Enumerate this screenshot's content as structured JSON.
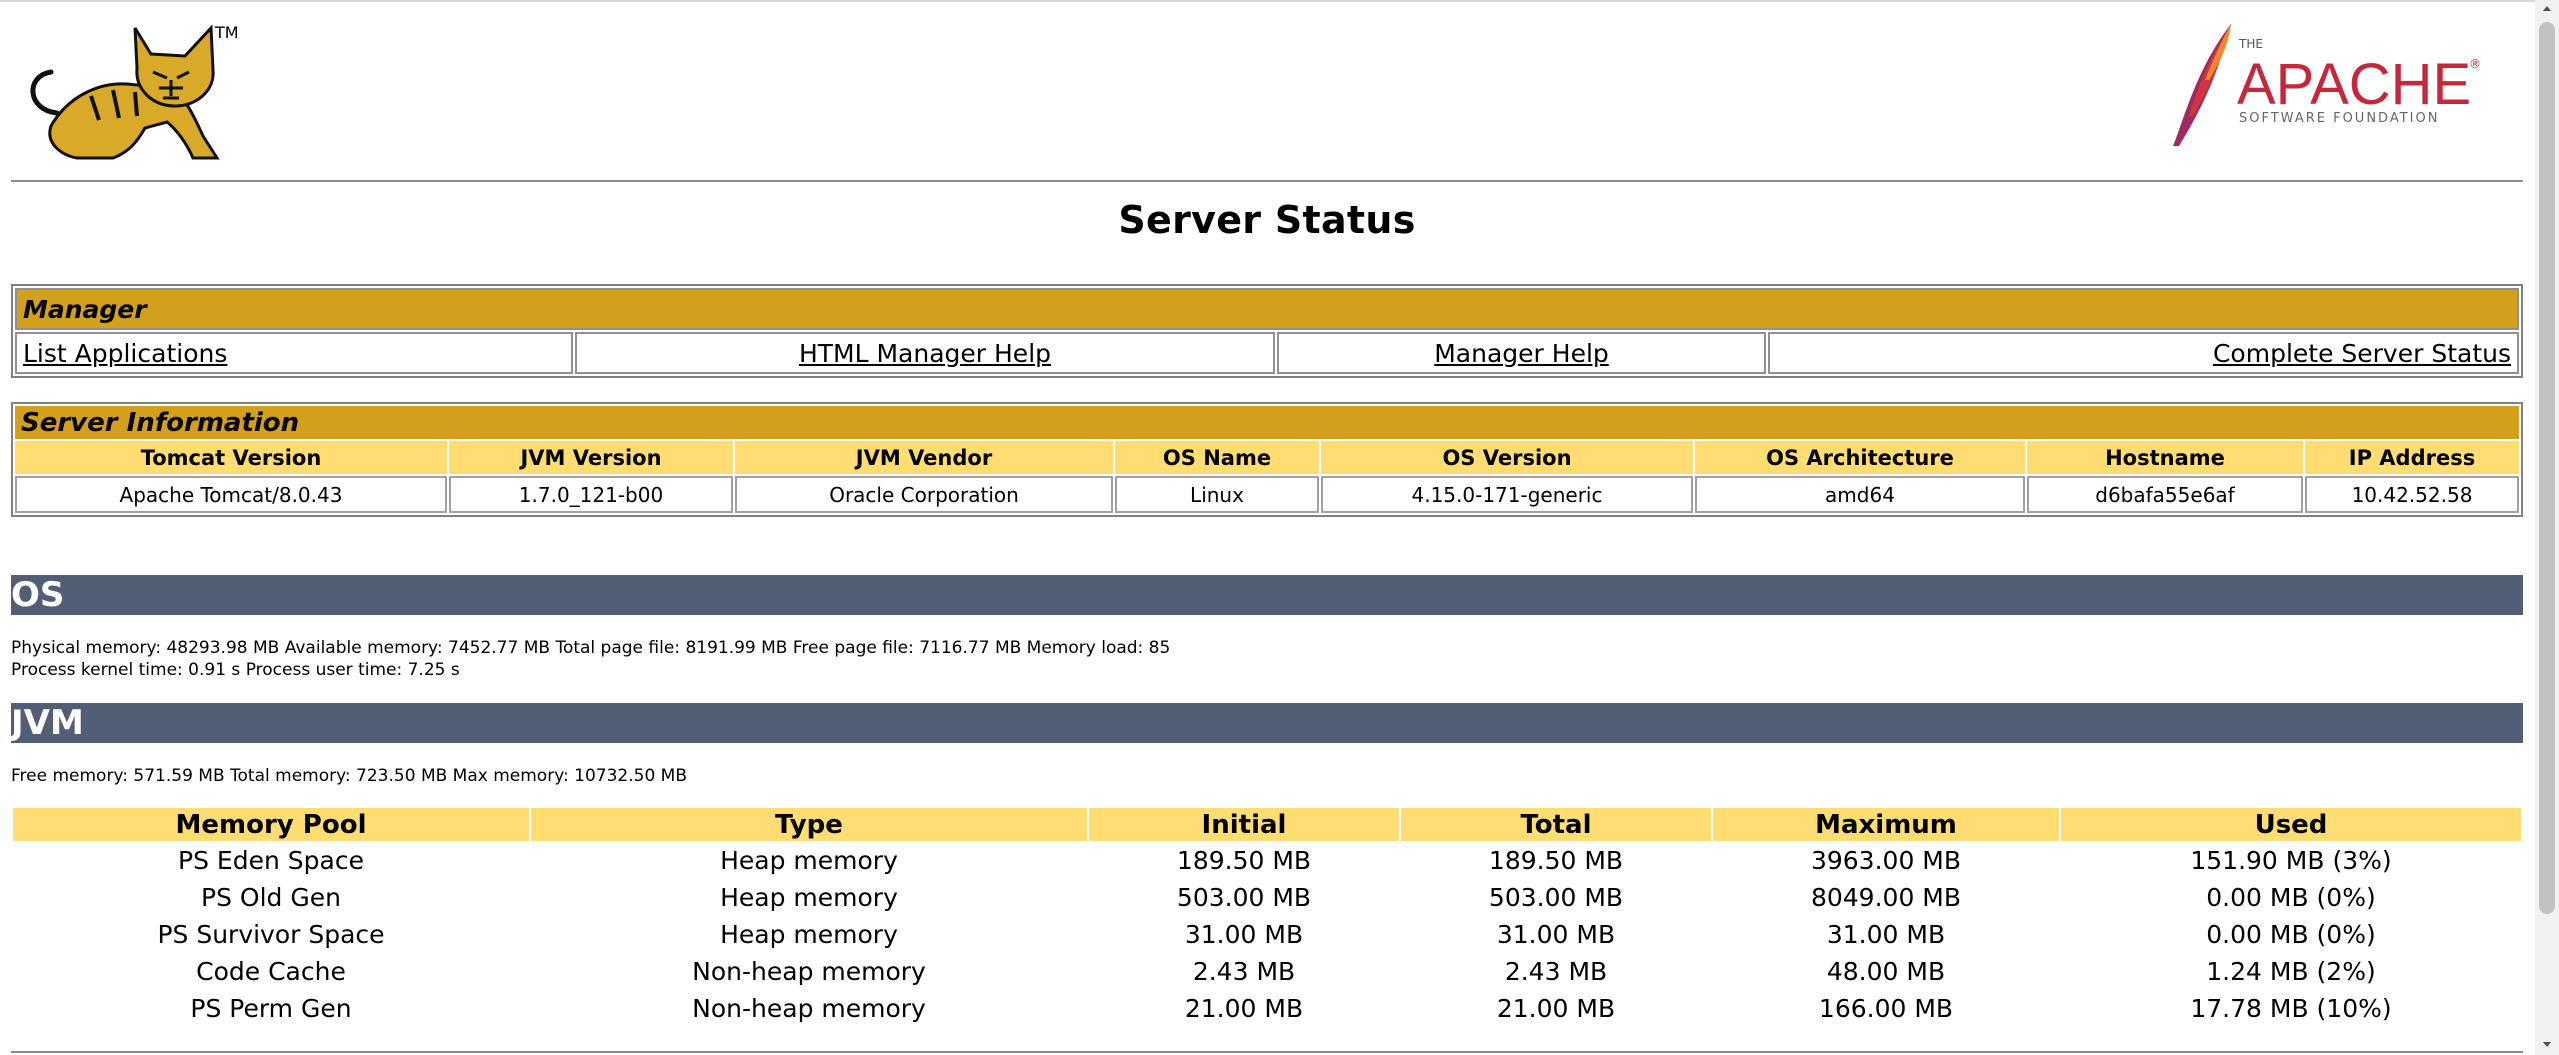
{
  "brand": {
    "tomcat_tm": "TM",
    "apache_the": "THE",
    "apache_name": "APACHE",
    "apache_tm": "®",
    "apache_sub": "SOFTWARE FOUNDATION"
  },
  "page_title": "Server Status",
  "manager": {
    "title": "Manager",
    "links": [
      "List Applications",
      "HTML Manager Help",
      "Manager Help",
      "Complete Server Status"
    ]
  },
  "server_info": {
    "title": "Server Information",
    "headers": [
      "Tomcat Version",
      "JVM Version",
      "JVM Vendor",
      "OS Name",
      "OS Version",
      "OS Architecture",
      "Hostname",
      "IP Address"
    ],
    "values": [
      "Apache Tomcat/8.0.43",
      "1.7.0_121-b00",
      "Oracle Corporation",
      "Linux",
      "4.15.0-171-generic",
      "amd64",
      "d6bafa55e6af",
      "10.42.52.58"
    ]
  },
  "os": {
    "title": "OS",
    "line1": "Physical memory: 48293.98 MB Available memory: 7452.77 MB Total page file: 8191.99 MB Free page file: 7116.77 MB Memory load: 85",
    "line2": "Process kernel time: 0.91 s Process user time: 7.25 s"
  },
  "jvm": {
    "title": "JVM",
    "line1": "Free memory: 571.59 MB Total memory: 723.50 MB Max memory: 10732.50 MB"
  },
  "memory_pools": {
    "headers": [
      "Memory Pool",
      "Type",
      "Initial",
      "Total",
      "Maximum",
      "Used"
    ],
    "rows": [
      [
        "PS Eden Space",
        "Heap memory",
        "189.50 MB",
        "189.50 MB",
        "3963.00 MB",
        "151.90 MB (3%)"
      ],
      [
        "PS Old Gen",
        "Heap memory",
        "503.00 MB",
        "503.00 MB",
        "8049.00 MB",
        "0.00 MB (0%)"
      ],
      [
        "PS Survivor Space",
        "Heap memory",
        "31.00 MB",
        "31.00 MB",
        "31.00 MB",
        "0.00 MB (0%)"
      ],
      [
        "Code Cache",
        "Non-heap memory",
        "2.43 MB",
        "2.43 MB",
        "48.00 MB",
        "1.24 MB (2%)"
      ],
      [
        "PS Perm Gen",
        "Non-heap memory",
        "21.00 MB",
        "21.00 MB",
        "166.00 MB",
        "17.78 MB (10%)"
      ]
    ]
  },
  "colors": {
    "section_title": "#d3a01b",
    "table_header": "#ffdd73",
    "bar": "#525d76"
  },
  "icons": [
    "tomcat-logo",
    "apache-feather-logo",
    "scroll-up-arrow",
    "scroll-down-arrow"
  ]
}
